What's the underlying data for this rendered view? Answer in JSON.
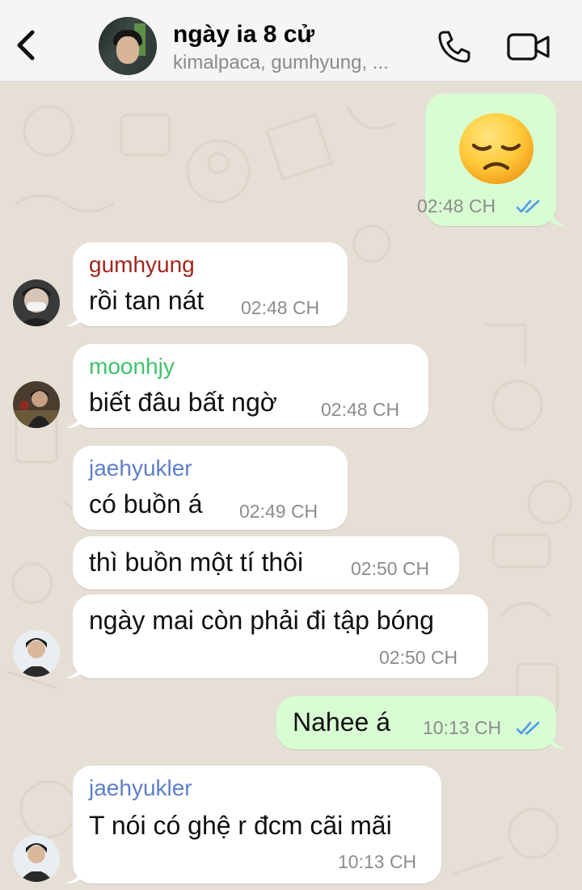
{
  "header": {
    "title": "ngày ia 8 cử",
    "subtitle": "kimalpaca, gumhyung, ..."
  },
  "colors": {
    "header_bg": "#f5f5f6",
    "chat_bg": "#e6dfd6",
    "incoming_bubble": "#ffffff",
    "outgoing_bubble": "#d9fdd3",
    "read_ticks": "#4f9bea",
    "sender_gumhyung": "#a3261f",
    "sender_moonhjy": "#3ec26b",
    "sender_jaehyukler": "#5f7fc9"
  },
  "messages": [
    {
      "direction": "out",
      "emoji": "disappointed-face",
      "time": "02:48 CH",
      "status": "read"
    },
    {
      "direction": "in",
      "sender": "gumhyung",
      "text": "rồi tan nát",
      "time": "02:48 CH"
    },
    {
      "direction": "in",
      "sender": "moonhjy",
      "text": "biết đâu bất ngờ",
      "time": "02:48 CH"
    },
    {
      "direction": "in",
      "sender": "jaehyukler",
      "text": "có buồn á",
      "time": "02:49 CH"
    },
    {
      "direction": "in",
      "text": "thì buồn một tí thôi",
      "time": "02:50 CH"
    },
    {
      "direction": "in",
      "text": "ngày mai còn phải đi tập bóng",
      "time": "02:50 CH"
    },
    {
      "direction": "out",
      "text": "Nahee á",
      "time": "10:13 CH",
      "status": "read"
    },
    {
      "direction": "in",
      "sender": "jaehyukler",
      "text": "T nói có ghệ r đcm cãi mãi",
      "time": "10:13 CH"
    }
  ],
  "icons": [
    "back-chevron-icon",
    "phone-icon",
    "video-camera-icon",
    "double-check-icon"
  ]
}
